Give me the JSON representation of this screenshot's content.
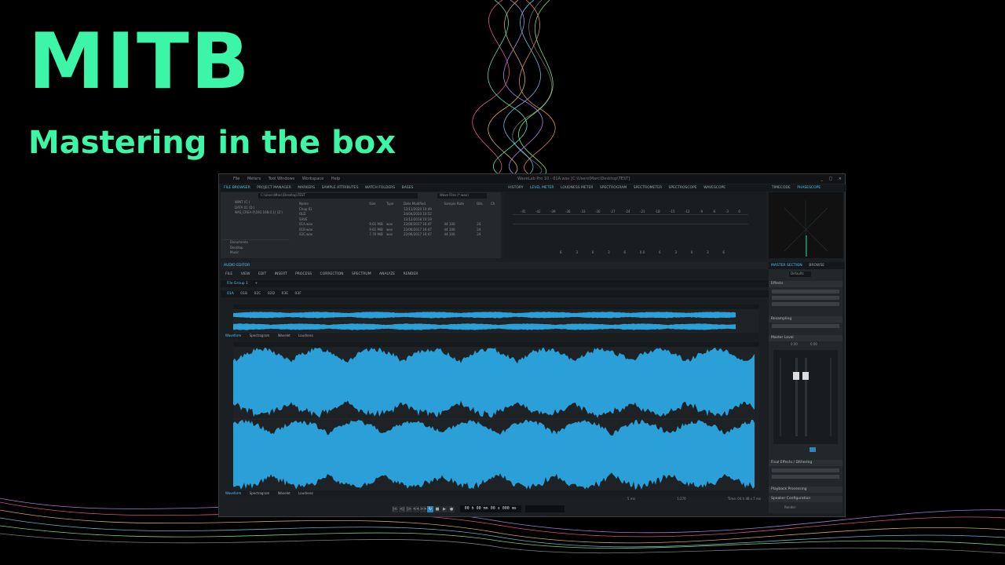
{
  "banner": {
    "title": "MITB",
    "subtitle": "Mastering in the box"
  },
  "colors": {
    "accent_green": "#3df5a6",
    "wave_blue": "#2a9fd8",
    "window_bg": "#1c1f22"
  },
  "window": {
    "menu": [
      "File",
      "Meters",
      "Tool Windows",
      "Workspace",
      "Help"
    ],
    "title": "WaveLab Pro 10 - 01A.wav [C:\\Users\\Marc\\Desktop\\TEST]",
    "controls": [
      "_",
      "□",
      "×"
    ]
  },
  "top_tabs_left": [
    "FILE BROWSER",
    "PROJECT MANAGER",
    "MARKERS",
    "SAMPLE ATTRIBUTES",
    "WATCH FOLDERS",
    "BASES"
  ],
  "file_browser": {
    "path": "C:\\Users\\Marc\\Desktop\\TEST",
    "filter": "Wave Files (*.wav)",
    "drives": [
      "WINT (C:)",
      "DATA 01 (D:)",
      "NAS_CREA (\\\\192.168.0.1) (Z:)"
    ],
    "favorites": [
      "Documents",
      "Desktop",
      "Music"
    ],
    "columns": [
      "Name",
      "Size",
      "Type",
      "Date Modified",
      "Sample Rate",
      "Bits",
      "Ch"
    ],
    "rows": [
      {
        "name": "Chap 01",
        "size": "",
        "type": "",
        "date": "12/11/2020 10:49",
        "rate": "",
        "bits": "",
        "ch": ""
      },
      {
        "name": "OLD",
        "size": "",
        "type": "",
        "date": "24/04/2020 10:52",
        "rate": "",
        "bits": "",
        "ch": ""
      },
      {
        "name": "SAVE",
        "size": "",
        "type": "",
        "date": "12/12/2018 10:19",
        "rate": "",
        "bits": "",
        "ch": ""
      },
      {
        "name": "01A.wav",
        "size": "9.61 MiB",
        "type": "wav",
        "date": "22/06/2017 16:47",
        "rate": "44 100",
        "bits": "24",
        "ch": ""
      },
      {
        "name": "01B.wav",
        "size": "9.61 MiB",
        "type": "wav",
        "date": "22/06/2017 16:47",
        "rate": "44 100",
        "bits": "24",
        "ch": ""
      },
      {
        "name": "02C.wav",
        "size": "7.76 MiB",
        "type": "wav",
        "date": "22/06/2017 16:47",
        "rate": "44 100",
        "bits": "24",
        "ch": ""
      }
    ]
  },
  "top_tabs_right": [
    "HISTORY",
    "LEVEL METER",
    "LOUDNESS METER",
    "SPECTROGRAM",
    "SPECTROMETER",
    "SPECTROSCOPE",
    "WAVESCOPE"
  ],
  "timecode_tabs": [
    "TIMECODE",
    "PHASESCOPE"
  ],
  "meter_scale": [
    "-45",
    "-42",
    "-39",
    "-36",
    "-33",
    "-30",
    "-27",
    "-24",
    "-21",
    "-18",
    "-15",
    "-12",
    "-9",
    "-6",
    "-3",
    "0"
  ],
  "meter_bottom_scale": [
    "6",
    "3",
    "0",
    "3",
    "6",
    "0.0",
    "6",
    "3",
    "0",
    "3",
    "6"
  ],
  "audio_editor": {
    "label": "AUDIO EDITOR",
    "ribbon": [
      "FILE",
      "VIEW",
      "EDIT",
      "INSERT",
      "PROCESS",
      "CORRECTION",
      "SPECTRUM",
      "ANALYZE",
      "RENDER"
    ],
    "file_group": "File Group 1",
    "file_tabs": [
      "01A",
      "01B",
      "02C",
      "02D",
      "03E",
      "03F"
    ],
    "view_tabs": [
      "Waveform",
      "Spectrogram",
      "Wavelet",
      "Loudness"
    ],
    "status": [
      "5 ms",
      "1:270",
      "Time: 04 h 48 s 7 ms"
    ]
  },
  "transport": {
    "timecode": "00 h 00 mn 00 s 000 ms"
  },
  "master_section": {
    "tabs": [
      "MASTER SECTION",
      "BROWSE"
    ],
    "preset": "Defaults",
    "effects_label": "Effects",
    "resampling_label": "Resampling",
    "master_level_label": "Master Level",
    "master_level_values": [
      "0.00",
      "0.00"
    ],
    "final_effects_label": "Final Effects / Dithering",
    "playback_label": "Playback Processing",
    "speaker_label": "Speaker Configuration",
    "render_label": "Render"
  }
}
